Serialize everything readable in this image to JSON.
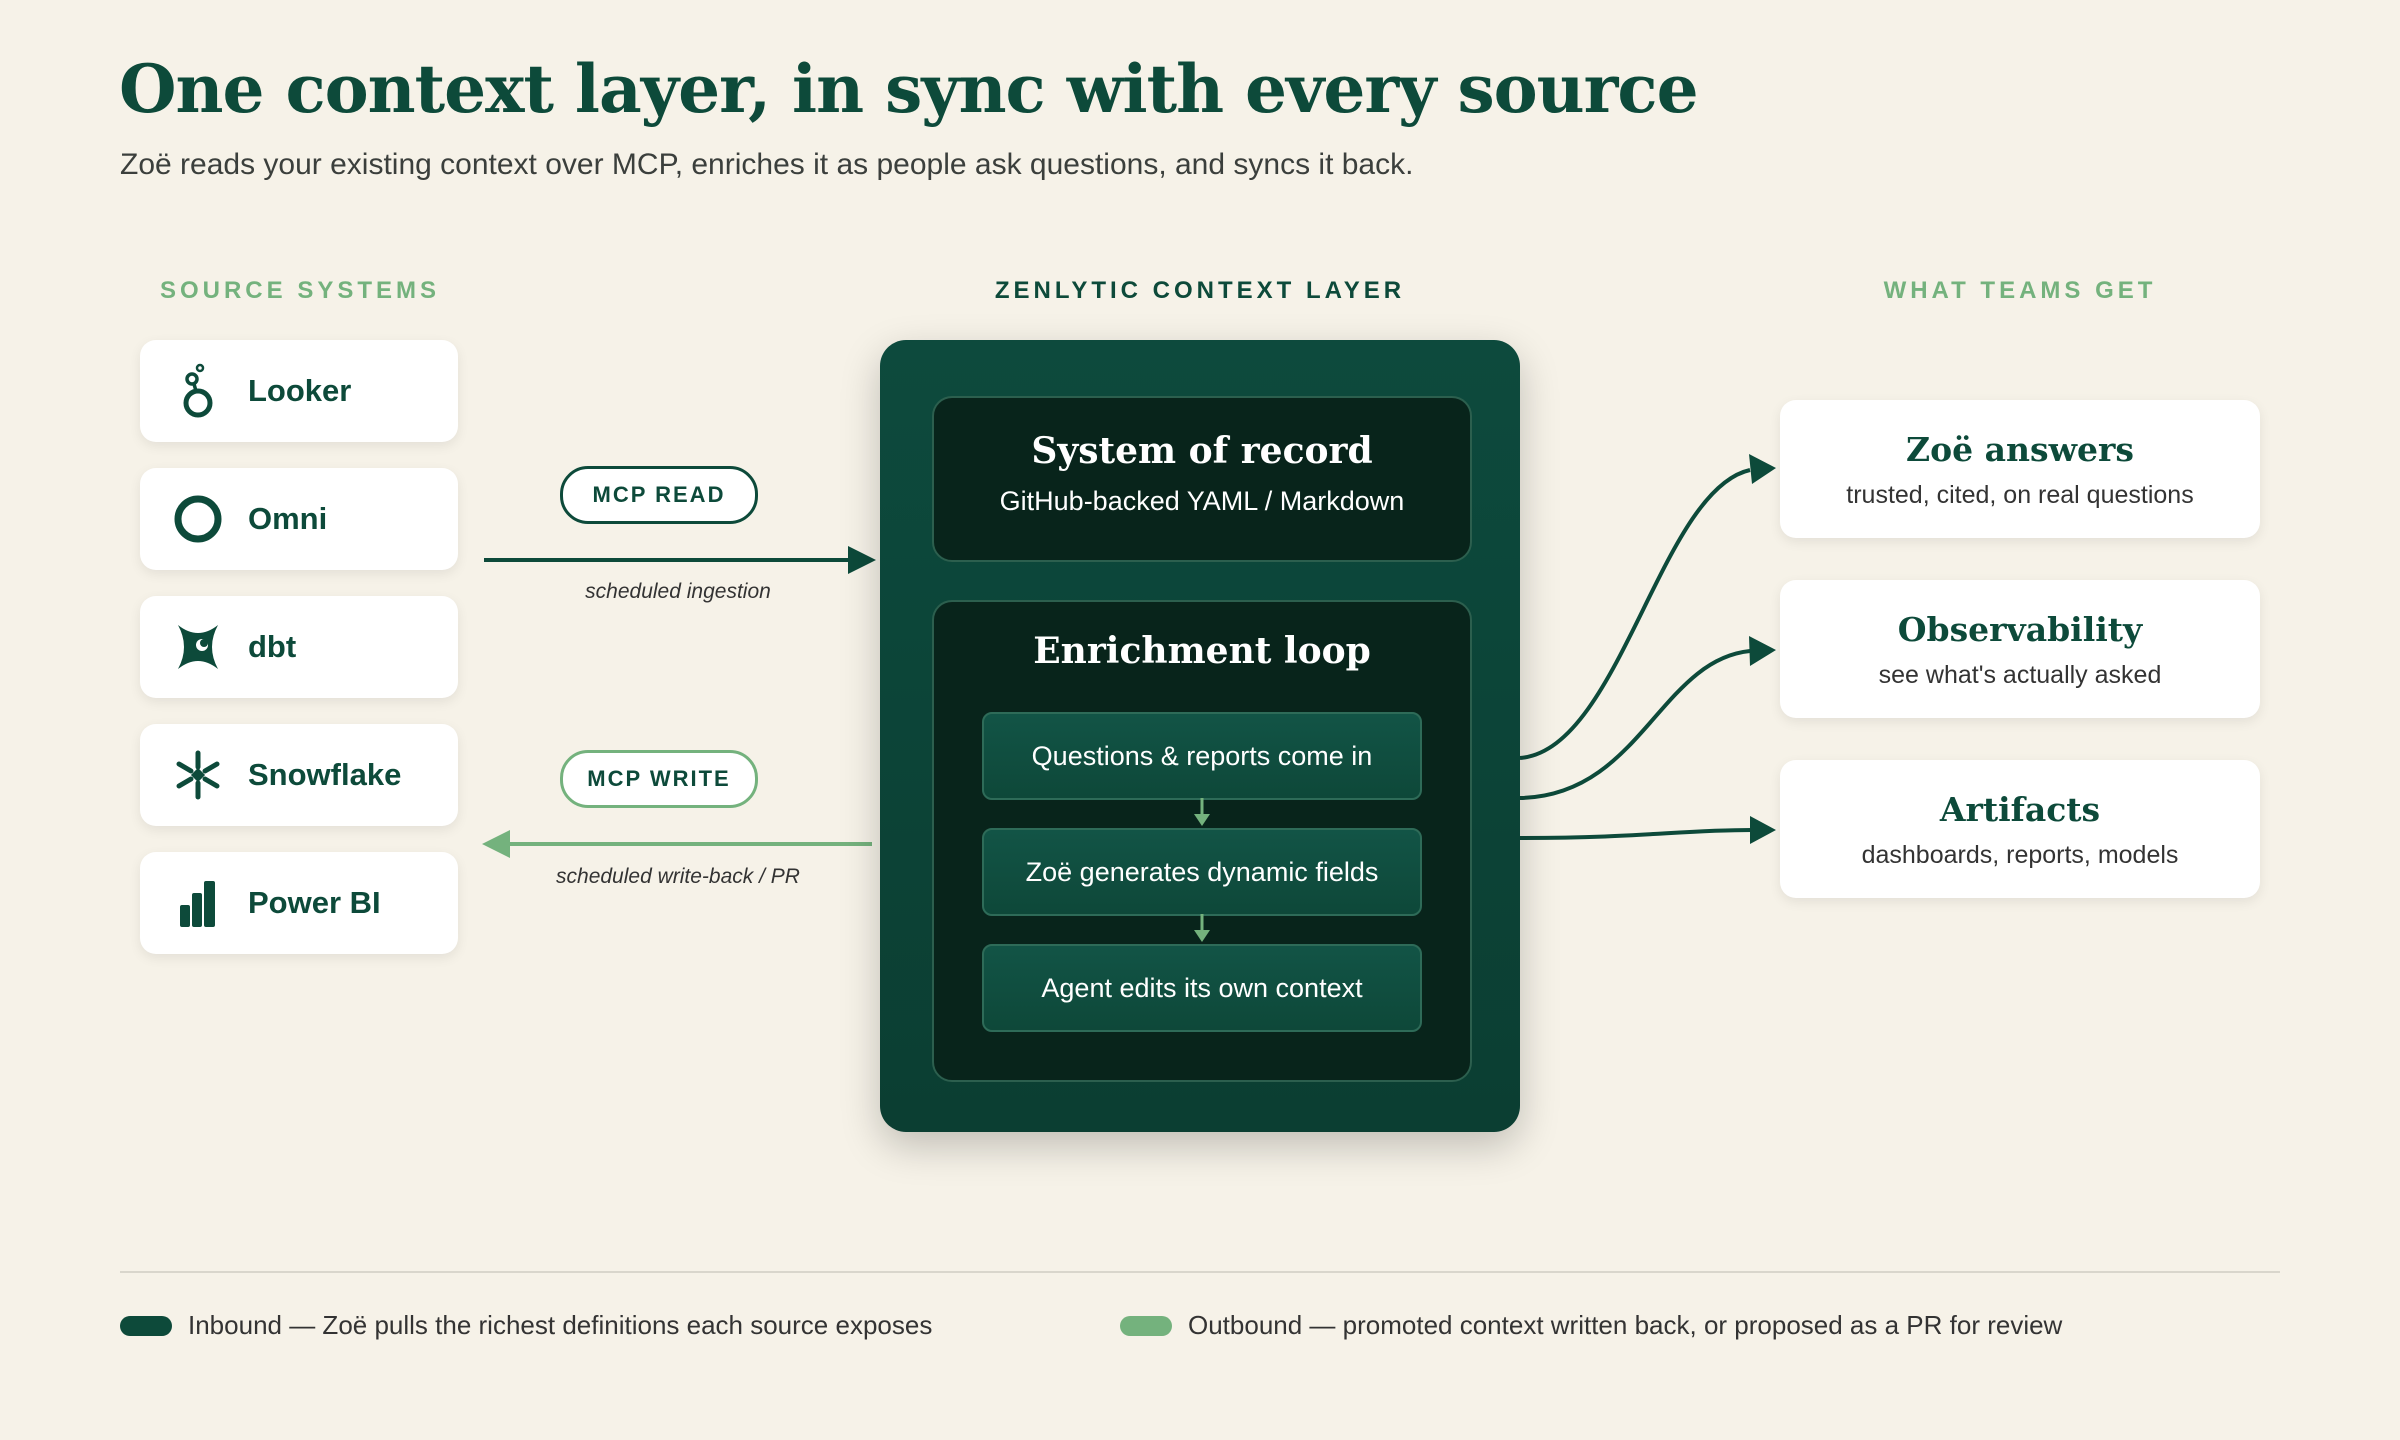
{
  "header": {
    "title": "One context layer, in sync with every source",
    "subtitle": "Zoë reads your existing context over MCP, enriches it as people ask questions, and syncs it back."
  },
  "columns": {
    "sources": "SOURCE SYSTEMS",
    "layer": "ZENLYTIC CONTEXT LAYER",
    "outcomes": "WHAT TEAMS GET"
  },
  "sources": [
    {
      "label": "Looker",
      "icon": "looker-icon"
    },
    {
      "label": "Omni",
      "icon": "omni-icon"
    },
    {
      "label": "dbt",
      "icon": "dbt-icon"
    },
    {
      "label": "Snowflake",
      "icon": "snowflake-icon"
    },
    {
      "label": "Power BI",
      "icon": "powerbi-icon"
    }
  ],
  "connectors": {
    "read": {
      "label": "MCP READ",
      "caption": "scheduled ingestion"
    },
    "write": {
      "label": "MCP WRITE",
      "caption": "scheduled write-back / PR"
    }
  },
  "layer": {
    "record": {
      "title": "System of record",
      "subtitle": "GitHub-backed YAML / Markdown"
    },
    "loop": {
      "title": "Enrichment loop",
      "steps": [
        "Questions & reports come in",
        "Zoë generates dynamic fields",
        "Agent edits its own context"
      ]
    }
  },
  "outcomes": [
    {
      "title": "Zoë answers",
      "subtitle": "trusted, cited, on real questions"
    },
    {
      "title": "Observability",
      "subtitle": "see what's actually asked"
    },
    {
      "title": "Artifacts",
      "subtitle": "dashboards, reports, models"
    }
  ],
  "legend": {
    "inbound": "Inbound — Zoë pulls the richest definitions each source exposes",
    "outbound": "Outbound — promoted context written back, or proposed as a PR for review"
  },
  "colors": {
    "dark_green": "#0d4a3a",
    "light_green": "#74b27d",
    "background": "#f6f2e8"
  }
}
